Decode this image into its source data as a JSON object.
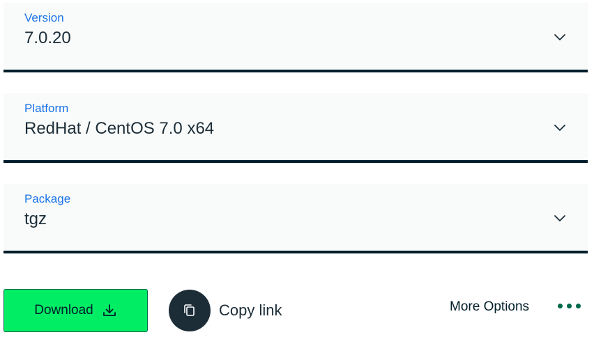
{
  "fields": {
    "version": {
      "label": "Version",
      "value": "7.0.20",
      "icon": "chevron-down-icon"
    },
    "platform": {
      "label": "Platform",
      "value": "RedHat / CentOS 7.0 x64",
      "icon": "chevron-down-icon"
    },
    "package": {
      "label": "Package",
      "value": "tgz",
      "icon": "chevron-down-icon"
    }
  },
  "actions": {
    "download_label": "Download",
    "download_icon": "download-icon",
    "copy_label": "Copy link",
    "copy_icon": "copy-icon",
    "more_options_label": "More Options",
    "more_icon": "ellipsis-icon"
  },
  "colors": {
    "label_blue": "#1a73e8",
    "field_bg": "#f9fbfa",
    "underline": "#001e2b",
    "download_green": "#00ed64",
    "download_border": "#00684a",
    "copy_circle": "#1c2d38",
    "dots_green": "#00684a"
  }
}
